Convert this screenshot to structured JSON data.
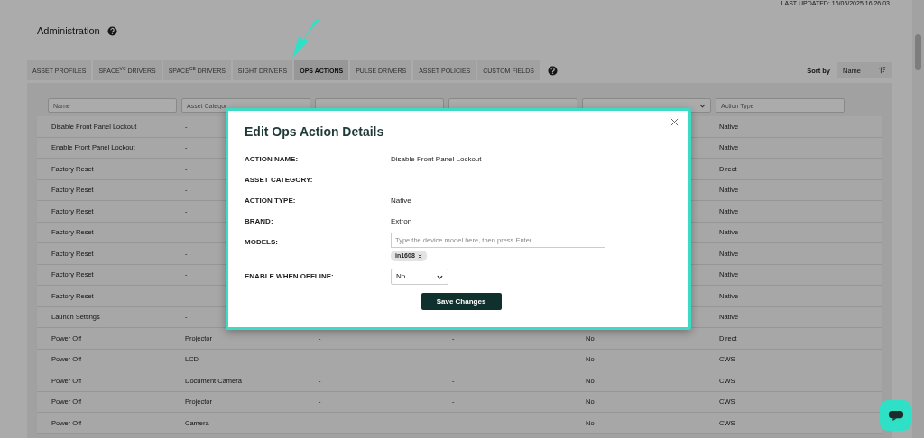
{
  "header": {
    "last_updated": "LAST UPDATED: 16/06/2025 16:26:03",
    "title": "Administration"
  },
  "tabs": [
    {
      "label": "ASSET PROFILES",
      "selected": false
    },
    {
      "label": "SPACE$^{VC}$ DRIVERS",
      "selected": false
    },
    {
      "label": "SPACE$^{CE}$ DRIVERS",
      "selected": false
    },
    {
      "label": "SIGHT DRIVERS",
      "selected": false
    },
    {
      "label": "OPS ACTIONS",
      "selected": true
    },
    {
      "label": "PULSE DRIVERS",
      "selected": false
    },
    {
      "label": "ASSET POLICIES",
      "selected": false
    },
    {
      "label": "CUSTOM FIELDS",
      "selected": false
    }
  ],
  "sort": {
    "label": "Sort by",
    "value": "Name"
  },
  "filters": [
    {
      "kind": "text",
      "placeholder": "Name"
    },
    {
      "kind": "text",
      "placeholder": "Asset Categor"
    },
    {
      "kind": "text"
    },
    {
      "kind": "text"
    },
    {
      "kind": "select"
    },
    {
      "kind": "text",
      "placeholder": "Action Type"
    }
  ],
  "rows": [
    {
      "name": "Disable Front Panel Lockout",
      "category": "-",
      "type": "Native"
    },
    {
      "name": "Enable Front Panel Lockout",
      "category": "-",
      "type": "Native"
    },
    {
      "name": "Factory Reset",
      "category": "-",
      "type": "Direct"
    },
    {
      "name": "Factory Reset",
      "category": "-",
      "type": "Native"
    },
    {
      "name": "Factory Reset",
      "category": "-",
      "type": "Native"
    },
    {
      "name": "Factory Reset",
      "category": "-",
      "type": "Native"
    },
    {
      "name": "Factory Reset",
      "category": "-",
      "type": "Native"
    },
    {
      "name": "Factory Reset",
      "category": "-",
      "type": "Native"
    },
    {
      "name": "Factory Reset",
      "category": "-",
      "type": "Native"
    },
    {
      "name": "Launch Settings",
      "category": "-",
      "type": "Native"
    },
    {
      "name": "Power Off",
      "category": "Projector",
      "brand": "-",
      "models": "-",
      "offline": "No",
      "type": "Direct"
    },
    {
      "name": "Power Off",
      "category": "LCD",
      "brand": "-",
      "models": "-",
      "offline": "No",
      "type": "CWS"
    },
    {
      "name": "Power Off",
      "category": "Document Camera",
      "brand": "-",
      "models": "-",
      "offline": "No",
      "type": "CWS"
    },
    {
      "name": "Power Off",
      "category": "Projector",
      "brand": "-",
      "models": "-",
      "offline": "No",
      "type": "CWS"
    },
    {
      "name": "Power Off",
      "category": "Camera",
      "brand": "-",
      "models": "-",
      "offline": "No",
      "type": "CWS"
    }
  ],
  "modal": {
    "title": "Edit Ops Action Details",
    "fields": [
      {
        "kind": "text",
        "label": "ACTION NAME:",
        "value": "Disable Front Panel Lockout"
      },
      {
        "kind": "text",
        "label": "ASSET CATEGORY:"
      },
      {
        "kind": "text",
        "label": "ACTION TYPE:",
        "value": "Native"
      },
      {
        "kind": "text",
        "label": "BRAND:",
        "value": "Extron"
      },
      {
        "kind": "tags",
        "label": "MODELS:",
        "placeholder": "Type the device model here, then press Enter",
        "tags": [
          "in1608"
        ]
      },
      {
        "kind": "select",
        "label": "ENABLE WHEN OFFLINE:",
        "value": "No"
      }
    ],
    "button": "Save Changes"
  }
}
